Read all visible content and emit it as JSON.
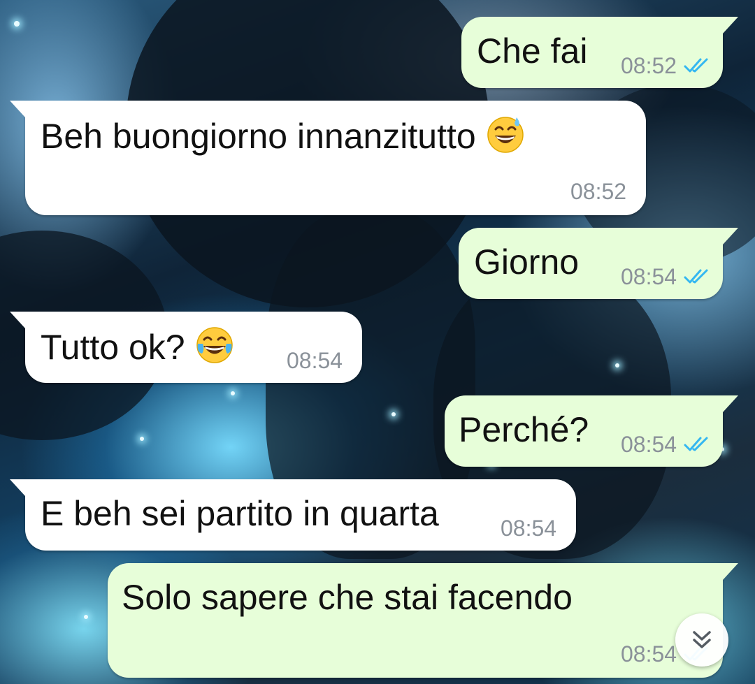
{
  "colors": {
    "outgoing_bubble": "#e7fed9",
    "incoming_bubble": "#ffffff",
    "read_ticks": "#34b7f1",
    "timestamp": "#8a9199"
  },
  "messages": [
    {
      "direction": "out",
      "text": "Che fai",
      "time": "08:52",
      "status": "read"
    },
    {
      "direction": "in",
      "text": "Beh buongiorno innanzitutto",
      "emoji": "grinning-face-with-sweat",
      "time": "08:52"
    },
    {
      "direction": "out",
      "text": "Giorno",
      "time": "08:54",
      "status": "read"
    },
    {
      "direction": "in",
      "text": "Tutto ok?",
      "emoji": "face-with-tears-of-joy",
      "time": "08:54"
    },
    {
      "direction": "out",
      "text": "Perché?",
      "time": "08:54",
      "status": "read"
    },
    {
      "direction": "in",
      "text": "E beh sei partito in quarta",
      "time": "08:54"
    },
    {
      "direction": "out",
      "text": "Solo sapere che stai facendo",
      "time": "08:54",
      "status": "read"
    }
  ],
  "scroll_button": {
    "icon": "double-chevron-down-icon"
  }
}
